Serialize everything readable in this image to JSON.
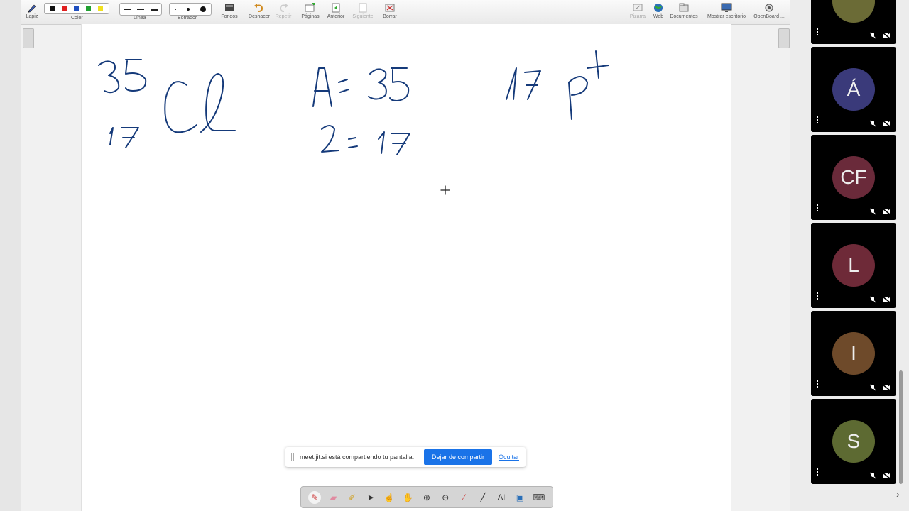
{
  "toolbar": {
    "pen_label": "Lapiz",
    "color_group_label": "Color",
    "line_group_label": "Línea",
    "eraser_group_label": "Borrador",
    "colors": [
      "#111111",
      "#e02020",
      "#2050c0",
      "#20a030",
      "#f0e020"
    ],
    "buttons": [
      {
        "label": "Fondos",
        "icon": "backgrounds-icon"
      },
      {
        "label": "Deshacer",
        "icon": "undo-icon"
      },
      {
        "label": "Repetir",
        "icon": "redo-icon"
      },
      {
        "label": "Páginas",
        "icon": "pages-icon"
      },
      {
        "label": "Anterior",
        "icon": "previous-icon"
      },
      {
        "label": "Siguiente",
        "icon": "next-icon"
      },
      {
        "label": "Borrar",
        "icon": "clear-icon"
      }
    ],
    "right_buttons": [
      {
        "label": "Pizarra",
        "icon": "board-icon"
      },
      {
        "label": "Web",
        "icon": "globe-icon"
      },
      {
        "label": "Documentos",
        "icon": "folder-icon"
      },
      {
        "label": "Mostrar escritorio",
        "icon": "desktop-icon"
      },
      {
        "label": "OpenBoard ...",
        "icon": "openboard-icon"
      }
    ]
  },
  "canvas": {
    "handwriting": [
      "35",
      "17",
      "Cl",
      "A = 35",
      "Z = 17",
      "17 p+"
    ]
  },
  "share_bar": {
    "message": "meet.jit.si está compartiendo tu pantalla.",
    "stop_label": "Dejar de compartir",
    "hide_label": "Ocultar"
  },
  "participants": [
    {
      "initial": "",
      "color": "#6b6b36"
    },
    {
      "initial": "Á",
      "color": "#3a3a7a"
    },
    {
      "initial": "CF",
      "color": "#6a2a3a"
    },
    {
      "initial": "L",
      "color": "#6e2a38"
    },
    {
      "initial": "I",
      "color": "#6e4a2a"
    },
    {
      "initial": "S",
      "color": "#5d6a32"
    }
  ]
}
